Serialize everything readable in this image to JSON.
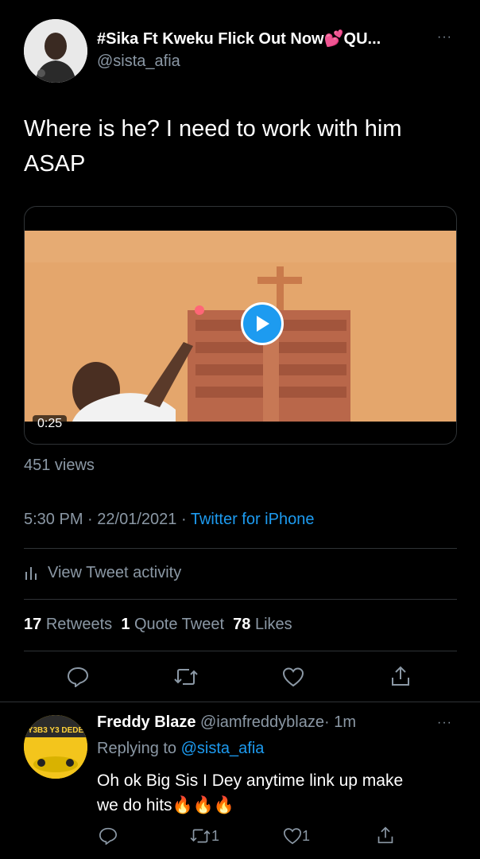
{
  "tweet": {
    "display_name": "#Sika Ft Kweku Flick Out Now",
    "name_suffix": "QU...",
    "handle": "@sista_afia",
    "more": "···",
    "text_line1": "Where is he? I need to work with him",
    "text_line2": "ASAP",
    "video_duration": "0:25",
    "views": "451 views",
    "time": "5:30 PM",
    "date": "22/01/2021",
    "sep": "·",
    "source": "Twitter for iPhone",
    "activity_label": "View Tweet activity",
    "stats": {
      "retweets_count": "17",
      "retweets_label": "Retweets",
      "quotes_count": "1",
      "quotes_label": "Quote Tweet",
      "likes_count": "78",
      "likes_label": "Likes"
    }
  },
  "reply": {
    "display_name": "Freddy Blaze",
    "handle": "@iamfreddyblaze",
    "time": "· 1m",
    "more": "···",
    "replying_prefix": "Replying to",
    "replying_to": "@sista_afia",
    "text_line1": "Oh ok Big Sis  I Dey anytime link up make",
    "text_line2": "we do hits🔥🔥🔥",
    "retweet_count": "1",
    "like_count": "1",
    "avatar_text": "Y3B3 Y3 DEDE"
  },
  "colors": {
    "accent": "#1d9bf0",
    "muted": "#8b98a5",
    "divider": "#2f3336"
  }
}
